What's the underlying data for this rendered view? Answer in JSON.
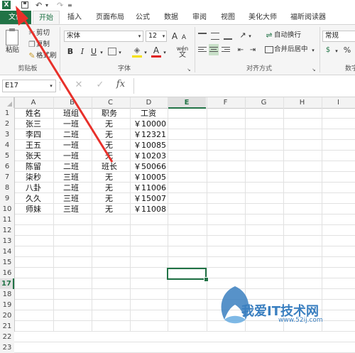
{
  "quick_access": {
    "excel_icon": "X",
    "save_icon": "save-icon",
    "undo_icon": "↶",
    "redo_icon": "↷"
  },
  "tabs": [
    "文件",
    "开始",
    "插入",
    "页面布局",
    "公式",
    "数据",
    "审阅",
    "视图",
    "美化大师",
    "福昕阅读器"
  ],
  "clipboard": {
    "paste": "粘贴",
    "cut": "剪切",
    "copy": "复制",
    "format_painter": "格式刷",
    "group": "剪贴板"
  },
  "font": {
    "name": "宋体",
    "size": "12",
    "bold": "B",
    "italic": "I",
    "underline": "U",
    "grow": "A",
    "shrink": "A",
    "wen": "wén",
    "group": "字体"
  },
  "alignment": {
    "wrap": "自动换行",
    "merge": "合并后居中",
    "group": "对齐方式"
  },
  "number": {
    "format": "常规",
    "percent": "%",
    "group": "数字"
  },
  "formula_bar": {
    "name_box": "E17",
    "fx": "fx",
    "value": ""
  },
  "columns": [
    "A",
    "B",
    "C",
    "D",
    "E",
    "F",
    "G",
    "H",
    "I"
  ],
  "rows": [
    "1",
    "2",
    "3",
    "4",
    "5",
    "6",
    "7",
    "8",
    "9",
    "10",
    "11",
    "12",
    "13",
    "14",
    "15",
    "16",
    "17",
    "18",
    "19",
    "20",
    "21",
    "22",
    "23"
  ],
  "table": {
    "header": [
      "姓名",
      "班组",
      "职务",
      "工资"
    ],
    "data": [
      [
        "张三",
        "一班",
        "无",
        "￥10000"
      ],
      [
        "李四",
        "二班",
        "无",
        "￥12321"
      ],
      [
        "王五",
        "一班",
        "无",
        "￥10085"
      ],
      [
        "张天",
        "一班",
        "无",
        "￥10203"
      ],
      [
        "陈留",
        "二班",
        "班长",
        "￥50066"
      ],
      [
        "柒秒",
        "三班",
        "无",
        "￥10005"
      ],
      [
        "八卦",
        "二班",
        "无",
        "￥11006"
      ],
      [
        "久久",
        "三班",
        "无",
        "￥15007"
      ],
      [
        "师妹",
        "三班",
        "无",
        "￥11008"
      ]
    ]
  },
  "colors": {
    "accent": "#217346",
    "arrow": "#e8302a",
    "watermark": "#3a7fc0"
  },
  "watermark": {
    "text": "我爱IT技术网",
    "url": "www.52ij.com"
  }
}
